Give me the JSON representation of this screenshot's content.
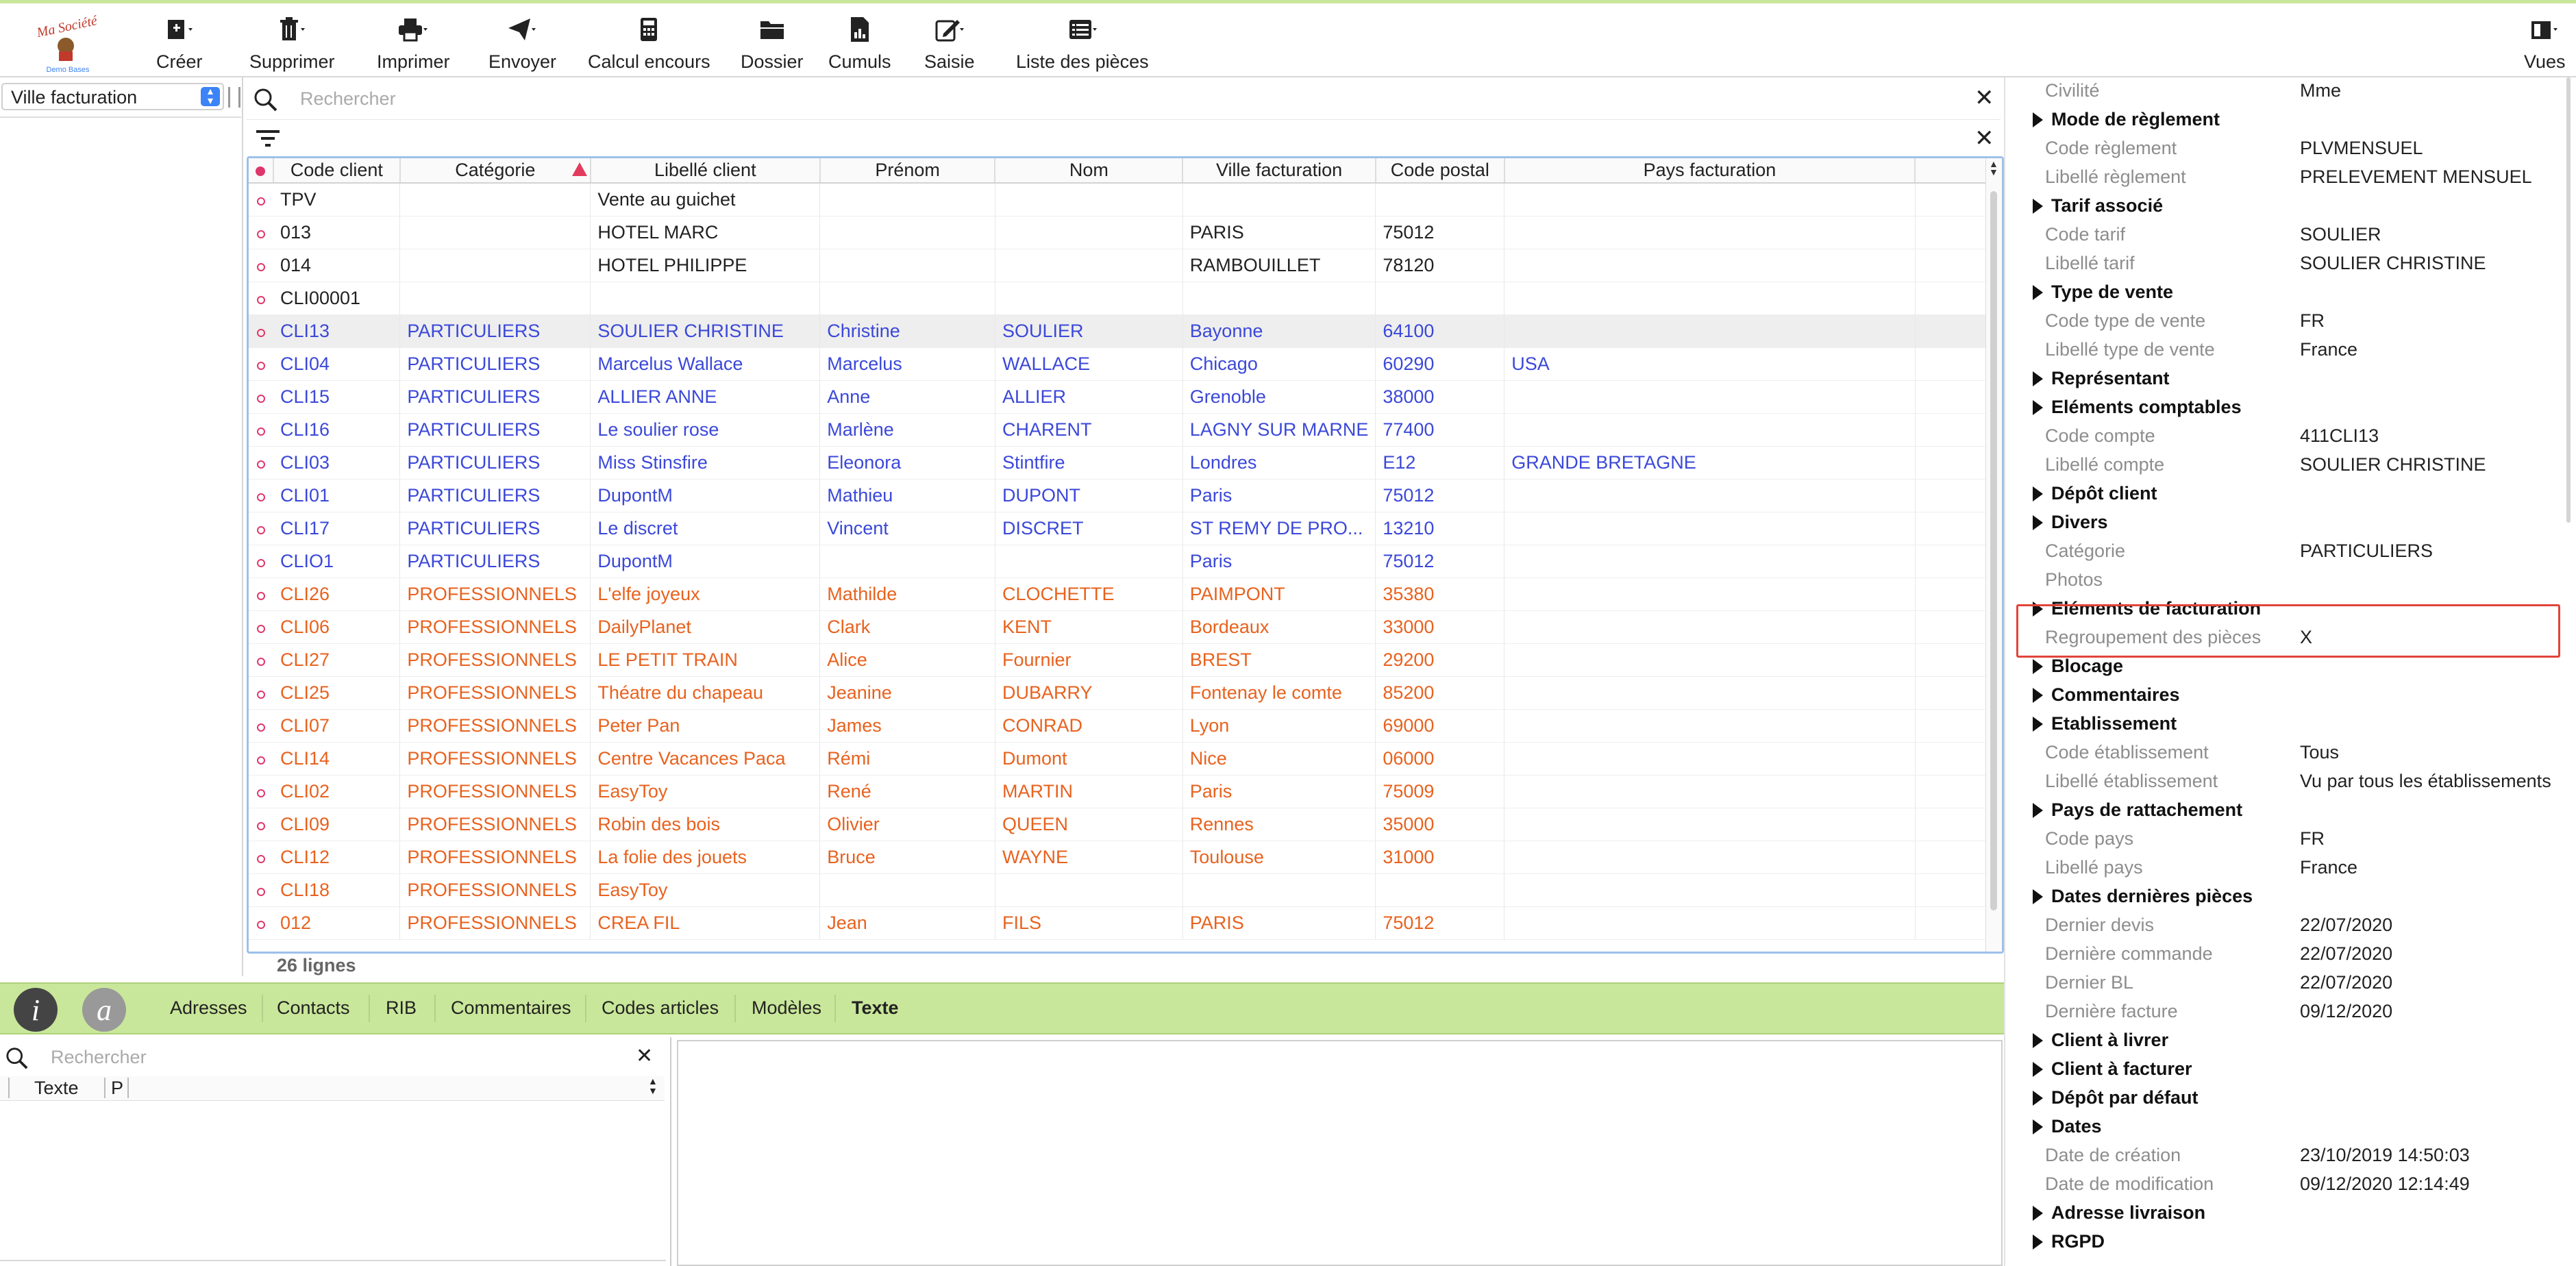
{
  "toolbar": {
    "logo": {
      "brand": "Ma Société",
      "sub": "Demo Bases"
    },
    "buttons": [
      {
        "label": "Créer",
        "icon": "add-document-icon"
      },
      {
        "label": "Supprimer",
        "icon": "trash-icon"
      },
      {
        "label": "Imprimer",
        "icon": "printer-icon"
      },
      {
        "label": "Envoyer",
        "icon": "paper-plane-icon"
      },
      {
        "label": "Calcul encours",
        "icon": "calculator-icon"
      },
      {
        "label": "Dossier",
        "icon": "folder-icon"
      },
      {
        "label": "Cumuls",
        "icon": "document-chart-icon"
      },
      {
        "label": "Saisie",
        "icon": "edit-icon"
      },
      {
        "label": "Liste des pièces",
        "icon": "list-icon"
      },
      {
        "label": "Vues",
        "icon": "views-icon"
      }
    ]
  },
  "left": {
    "filter_value": "Ville facturation"
  },
  "grid": {
    "search_placeholder": "Rechercher",
    "columns": [
      "Code client",
      "Catégorie",
      "Libellé client",
      "Prénom",
      "Nom",
      "Ville facturation",
      "Code postal",
      "Pays facturation"
    ],
    "rows": [
      {
        "style": "normal",
        "cells": [
          "TPV",
          "",
          "Vente au guichet",
          "",
          "",
          "",
          "",
          ""
        ]
      },
      {
        "style": "normal",
        "cells": [
          "013",
          "",
          "HOTEL MARC",
          "",
          "",
          "PARIS",
          "75012",
          ""
        ]
      },
      {
        "style": "normal",
        "cells": [
          "014",
          "",
          "HOTEL PHILIPPE",
          "",
          "",
          "RAMBOUILLET",
          "78120",
          ""
        ]
      },
      {
        "style": "normal",
        "cells": [
          "CLI00001",
          "",
          "",
          "",
          "",
          "",
          "",
          ""
        ]
      },
      {
        "style": "blue sel",
        "cells": [
          "CLI13",
          "PARTICULIERS",
          "SOULIER CHRISTINE",
          "Christine",
          "SOULIER",
          "Bayonne",
          "64100",
          ""
        ]
      },
      {
        "style": "blue",
        "cells": [
          "CLI04",
          "PARTICULIERS",
          "Marcelus Wallace",
          "Marcelus",
          "WALLACE",
          "Chicago",
          "60290",
          "USA"
        ]
      },
      {
        "style": "blue",
        "cells": [
          "CLI15",
          "PARTICULIERS",
          "ALLIER ANNE",
          "Anne",
          "ALLIER",
          "Grenoble",
          "38000",
          ""
        ]
      },
      {
        "style": "blue",
        "cells": [
          "CLI16",
          "PARTICULIERS",
          "Le soulier rose",
          "Marlène",
          "CHARENT",
          "LAGNY SUR MARNE",
          "77400",
          ""
        ]
      },
      {
        "style": "blue",
        "cells": [
          "CLI03",
          "PARTICULIERS",
          "Miss Stinsfire",
          "Eleonora",
          "Stintfire",
          "Londres",
          "E12",
          "GRANDE BRETAGNE"
        ]
      },
      {
        "style": "blue",
        "cells": [
          "CLI01",
          "PARTICULIERS",
          "DupontM",
          "Mathieu",
          "DUPONT",
          "Paris",
          "75012",
          ""
        ]
      },
      {
        "style": "blue",
        "cells": [
          "CLI17",
          "PARTICULIERS",
          "Le discret",
          "Vincent",
          "DISCRET",
          "ST REMY DE PRO...",
          "13210",
          ""
        ]
      },
      {
        "style": "blue",
        "cells": [
          "CLIO1",
          "PARTICULIERS",
          "DupontM",
          "",
          "",
          "Paris",
          "75012",
          ""
        ]
      },
      {
        "style": "orange",
        "cells": [
          "CLI26",
          "PROFESSIONNELS",
          "L'elfe joyeux",
          "Mathilde",
          "CLOCHETTE",
          "PAIMPONT",
          "35380",
          ""
        ]
      },
      {
        "style": "orange",
        "cells": [
          "CLI06",
          "PROFESSIONNELS",
          "DailyPlanet",
          "Clark",
          "KENT",
          "Bordeaux",
          "33000",
          ""
        ]
      },
      {
        "style": "orange",
        "cells": [
          "CLI27",
          "PROFESSIONNELS",
          "LE PETIT TRAIN",
          "Alice",
          "Fournier",
          "BREST",
          "29200",
          ""
        ]
      },
      {
        "style": "orange",
        "cells": [
          "CLI25",
          "PROFESSIONNELS",
          "Théatre du chapeau",
          "Jeanine",
          "DUBARRY",
          "Fontenay le comte",
          "85200",
          ""
        ]
      },
      {
        "style": "orange",
        "cells": [
          "CLI07",
          "PROFESSIONNELS",
          "Peter Pan",
          "James",
          "CONRAD",
          "Lyon",
          "69000",
          ""
        ]
      },
      {
        "style": "orange",
        "cells": [
          "CLI14",
          "PROFESSIONNELS",
          "Centre Vacances Paca",
          "Rémi",
          "Dumont",
          "Nice",
          "06000",
          ""
        ]
      },
      {
        "style": "orange",
        "cells": [
          "CLI02",
          "PROFESSIONNELS",
          "EasyToy",
          "René",
          "MARTIN",
          "Paris",
          "75009",
          ""
        ]
      },
      {
        "style": "orange",
        "cells": [
          "CLI09",
          "PROFESSIONNELS",
          "Robin des bois",
          "Olivier",
          "QUEEN",
          "Rennes",
          "35000",
          ""
        ]
      },
      {
        "style": "orange",
        "cells": [
          "CLI12",
          "PROFESSIONNELS",
          "La folie des jouets",
          "Bruce",
          "WAYNE",
          "Toulouse",
          "31000",
          ""
        ]
      },
      {
        "style": "orange",
        "cells": [
          "CLI18",
          "PROFESSIONNELS",
          "EasyToy",
          "",
          "",
          "",
          "",
          ""
        ]
      },
      {
        "style": "orange",
        "cells": [
          "012",
          "PROFESSIONNELS",
          "CREA FIL",
          "Jean",
          "FILS",
          "PARIS",
          "75012",
          ""
        ]
      }
    ],
    "line_count": "26 lignes"
  },
  "tabs": {
    "info_icon_glyph": "i",
    "at_icon_glyph": "a",
    "items": [
      "Adresses",
      "Contacts",
      "RIB",
      "Commentaires",
      "Codes articles",
      "Modèles",
      "Texte"
    ],
    "active": "Texte"
  },
  "bottom": {
    "search_placeholder": "Rechercher",
    "col_texte": "Texte",
    "col_p": "P"
  },
  "detail": {
    "rows": [
      {
        "type": "field",
        "label": "Civilité",
        "value": "Mme"
      },
      {
        "type": "section",
        "label": "Mode de règlement"
      },
      {
        "type": "field",
        "label": "Code règlement",
        "value": "PLVMENSUEL"
      },
      {
        "type": "field",
        "label": "Libellé règlement",
        "value": "PRELEVEMENT MENSUEL"
      },
      {
        "type": "section",
        "label": "Tarif associé"
      },
      {
        "type": "field",
        "label": "Code tarif",
        "value": "SOULIER"
      },
      {
        "type": "field",
        "label": "Libellé tarif",
        "value": "SOULIER CHRISTINE"
      },
      {
        "type": "section",
        "label": "Type de vente"
      },
      {
        "type": "field",
        "label": "Code type de vente",
        "value": "FR"
      },
      {
        "type": "field",
        "label": "Libellé type de vente",
        "value": "France"
      },
      {
        "type": "section",
        "label": "Représentant"
      },
      {
        "type": "section",
        "label": "Eléments comptables"
      },
      {
        "type": "field",
        "label": "Code compte",
        "value": "411CLI13"
      },
      {
        "type": "field",
        "label": "Libellé compte",
        "value": "SOULIER CHRISTINE"
      },
      {
        "type": "section",
        "label": "Dépôt client"
      },
      {
        "type": "section",
        "label": "Divers"
      },
      {
        "type": "field",
        "label": "Catégorie",
        "value": "PARTICULIERS"
      },
      {
        "type": "field",
        "label": "Photos",
        "value": ""
      },
      {
        "type": "section",
        "label": "Eléments de facturation"
      },
      {
        "type": "field",
        "label": "Regroupement des pièces",
        "value": "X"
      },
      {
        "type": "section",
        "label": "Blocage"
      },
      {
        "type": "section",
        "label": "Commentaires"
      },
      {
        "type": "section",
        "label": "Etablissement"
      },
      {
        "type": "field",
        "label": "Code établissement",
        "value": "Tous"
      },
      {
        "type": "field",
        "label": "Libellé établissement",
        "value": "Vu par tous les établissements"
      },
      {
        "type": "section",
        "label": "Pays de rattachement"
      },
      {
        "type": "field",
        "label": "Code pays",
        "value": "FR"
      },
      {
        "type": "field",
        "label": "Libellé pays",
        "value": "France"
      },
      {
        "type": "section",
        "label": "Dates dernières pièces"
      },
      {
        "type": "field",
        "label": "Dernier devis",
        "value": "22/07/2020"
      },
      {
        "type": "field",
        "label": "Dernière commande",
        "value": "22/07/2020"
      },
      {
        "type": "field",
        "label": "Dernier BL",
        "value": "22/07/2020"
      },
      {
        "type": "field",
        "label": "Dernière facture",
        "value": "09/12/2020"
      },
      {
        "type": "section",
        "label": "Client à livrer"
      },
      {
        "type": "section",
        "label": "Client à facturer"
      },
      {
        "type": "section",
        "label": "Dépôt par défaut"
      },
      {
        "type": "section",
        "label": "Dates"
      },
      {
        "type": "field",
        "label": "Date de création",
        "value": "23/10/2019 14:50:03"
      },
      {
        "type": "field",
        "label": "Date de modification",
        "value": "09/12/2020 12:14:49"
      },
      {
        "type": "section",
        "label": "Adresse livraison"
      },
      {
        "type": "section",
        "label": "RGPD"
      }
    ]
  },
  "colors": {
    "accent_green": "#c9e79a",
    "blue_rows": "#3b48d9",
    "orange_rows": "#e8621e",
    "highlight": "#e1443a",
    "selection_blue": "#9dc1ea"
  }
}
